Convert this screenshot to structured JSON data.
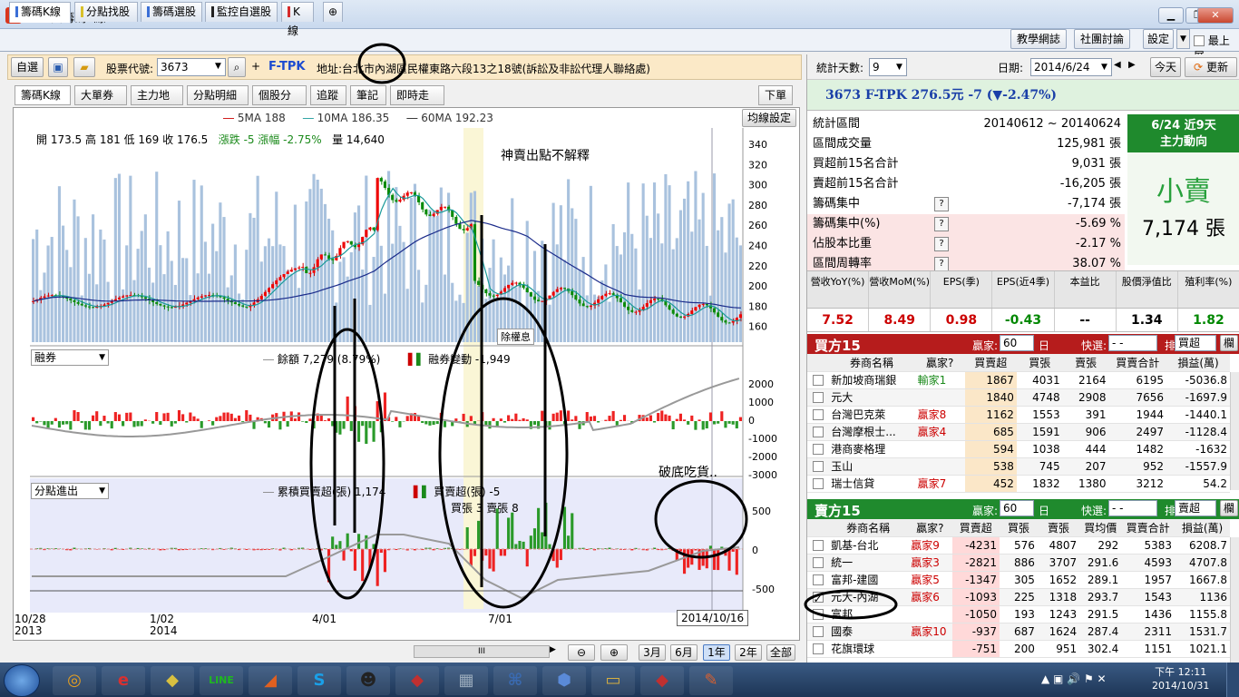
{
  "window": {
    "title": "理財寶籌碼K線",
    "min": "▁",
    "max": "❐",
    "close": "✕"
  },
  "main_tabs": [
    {
      "label": "籌碼K線",
      "color": "#3b6fd6"
    },
    {
      "label": "分點找股",
      "color": "#d8c02a"
    },
    {
      "label": "籌碼選股",
      "color": "#3b6fd6"
    },
    {
      "label": "監控自選股",
      "color": "#222222"
    },
    {
      "label": "K線",
      "color": "#d62b2b"
    }
  ],
  "right_buttons": {
    "weekly": "教學網誌",
    "forum": "社團討論",
    "settings": "設定",
    "ontop": "最上層"
  },
  "toolbar": {
    "select": "自選",
    "stock_label": "股票代號:",
    "stock_code": "3673",
    "stock_name": "F-TPK",
    "address": "地址:台北市內湖區民權東路六段13之18號(訴訟及非訟代理人聯絡處)"
  },
  "sub_tabs": [
    "籌碼K線",
    "大單券商",
    "主力地圖",
    "分點明細",
    "個股分析",
    "追蹤",
    "筆記",
    "即時走勢"
  ],
  "subtab_right": "下單",
  "chart": {
    "ma_legend": {
      "ma5": "5MA 188",
      "ma10": "10MA 186.35",
      "ma60": "60MA 192.23"
    },
    "ma_settings": "均線設定",
    "ohlc": {
      "open": "開 173.5",
      "high": "高 181",
      "low": "低 169",
      "close": "收 176.5",
      "change": "漲跌 -5",
      "pct": "漲幅 -2.75%",
      "vol": "量 14,640"
    },
    "annotation1": "神賣出點不解釋",
    "annotation2": "破底吃貨..",
    "ex_div": "除權息",
    "panel2_select": "融券",
    "panel2_legend1": "餘額 7,279 (8.79%)",
    "panel2_legend2": "融券變動 -1,949",
    "panel3_select": "分點進出",
    "panel3_legend1": "累積買賣超(張) 1,174",
    "panel3_legend2": "買賣超(張) -5",
    "panel3_legend3": "買張 3 賣張 8",
    "price_ticks": [
      "340",
      "320",
      "300",
      "280",
      "260",
      "240",
      "220",
      "200",
      "180",
      "160"
    ],
    "p2_ticks": [
      "2000",
      "1000",
      "0",
      "-1000",
      "-2000",
      "-3000"
    ],
    "p3_ticks": [
      "500",
      "0",
      "-500"
    ],
    "x_labels": [
      {
        "d": "10/28",
        "y": "2013"
      },
      {
        "d": "1/02",
        "y": "2014"
      },
      {
        "d": "4/01",
        "y": ""
      },
      {
        "d": "7/01",
        "y": ""
      }
    ],
    "cursor_date": "2014/10/16",
    "zoom": [
      "3月",
      "6月",
      "1年",
      "2年",
      "全部"
    ]
  },
  "right": {
    "days_label": "統計天數:",
    "days": "9",
    "date_label": "日期:",
    "date": "2014/6/24",
    "today": "今天",
    "refresh": "更新",
    "header": "3673 F-TPK  276.5元 -7 (▼-2.47%)",
    "stats": [
      {
        "k": "統計區間",
        "v": "20140612 ~ 20140624"
      },
      {
        "k": "區間成交量",
        "v": "125,981 張"
      },
      {
        "k": "買超前15名合計",
        "v": "9,031 張"
      },
      {
        "k": "賣超前15名合計",
        "v": "-16,205 張"
      },
      {
        "k": "籌碼集中",
        "v": "-7,174 張"
      },
      {
        "k": "籌碼集中(%)",
        "v": "-5.69 %"
      },
      {
        "k": "佔股本比重",
        "v": "-2.17 %"
      },
      {
        "k": "區間周轉率",
        "v": "38.07 %"
      }
    ],
    "badge": {
      "title": "6/24 近9天",
      "sub": "主力動向",
      "verdict": "小賣",
      "amount": "7,174 張"
    },
    "fin_headers": [
      "營收YoY(%)",
      "營收MoM(%)",
      "EPS(季)",
      "EPS(近4季)",
      "本益比",
      "股價淨值比",
      "殖利率(%)"
    ],
    "fin_values": [
      "7.52",
      "8.49",
      "0.98",
      "-0.43",
      "--",
      "1.34",
      "1.82"
    ],
    "buy": {
      "title": "買方15",
      "winner_label": "贏家:",
      "count": "60",
      "unit": "日",
      "quick": "快選:",
      "quick_v": "- -",
      "sort": "排序:",
      "sort_v": "買超",
      "btn": "欄",
      "headers": [
        "券商名稱",
        "贏家?",
        "買賣超",
        "買張",
        "賣張",
        "買賣合計",
        "損益(萬)"
      ],
      "rows": [
        [
          "新加坡商瑞銀",
          "輸家1",
          "1867",
          "4031",
          "2164",
          "6195",
          "-5036.8"
        ],
        [
          "元大",
          "",
          "1840",
          "4748",
          "2908",
          "7656",
          "-1697.9"
        ],
        [
          "台灣巴克萊",
          "贏家8",
          "1162",
          "1553",
          "391",
          "1944",
          "-1440.1"
        ],
        [
          "台灣摩根士...",
          "贏家4",
          "685",
          "1591",
          "906",
          "2497",
          "-1128.4"
        ],
        [
          "港商麥格理",
          "",
          "594",
          "1038",
          "444",
          "1482",
          "-1632"
        ],
        [
          "玉山",
          "",
          "538",
          "745",
          "207",
          "952",
          "-1557.9"
        ],
        [
          "瑞士信貸",
          "贏家7",
          "452",
          "1832",
          "1380",
          "3212",
          "54.2"
        ]
      ]
    },
    "sell": {
      "title": "賣方15",
      "winner_label": "贏家:",
      "count": "60",
      "unit": "日",
      "quick": "快選:",
      "quick_v": "- -",
      "sort": "排序:",
      "sort_v": "賣超",
      "btn": "欄",
      "headers": [
        "券商名稱",
        "贏家?",
        "買賣超",
        "買張",
        "賣張",
        "買均價",
        "買賣合計",
        "損益(萬)"
      ],
      "rows": [
        [
          "凱基-台北",
          "贏家9",
          "-4231",
          "576",
          "4807",
          "292",
          "5383",
          "6208.7"
        ],
        [
          "統一",
          "贏家3",
          "-2821",
          "886",
          "3707",
          "291.6",
          "4593",
          "4707.8"
        ],
        [
          "富邦-建國",
          "贏家5",
          "-1347",
          "305",
          "1652",
          "289.1",
          "1957",
          "1667.8"
        ],
        [
          "元大-內湖",
          "贏家6",
          "-1093",
          "225",
          "1318",
          "293.7",
          "1543",
          "1136"
        ],
        [
          "富邦",
          "",
          "-1050",
          "193",
          "1243",
          "291.5",
          "1436",
          "1155.8"
        ],
        [
          "國泰",
          "贏家10",
          "-937",
          "687",
          "1624",
          "287.4",
          "2311",
          "1531.7"
        ],
        [
          "花旗環球",
          "",
          "-751",
          "200",
          "951",
          "302.4",
          "1151",
          "1021.1"
        ]
      ]
    }
  },
  "taskbar": {
    "time": "下午 12:11",
    "date": "2014/10/31"
  }
}
